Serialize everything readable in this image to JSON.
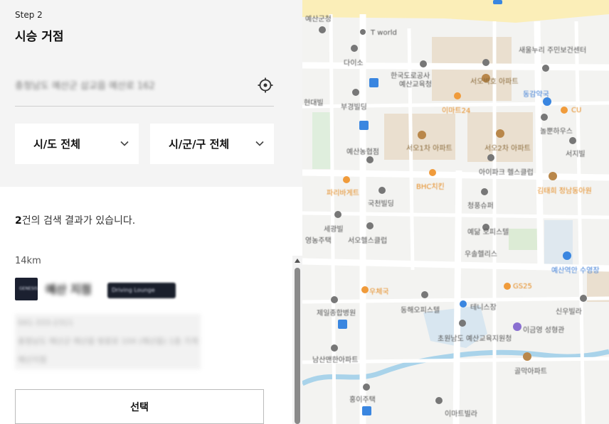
{
  "step": {
    "label": "Step 2",
    "title": "시승 거점"
  },
  "search": {
    "address": "충청남도 예산군 삽교읍 예산로 162",
    "locate_icon": "crosshair-icon"
  },
  "filters": {
    "province": {
      "label": "시/도 전체",
      "icon": "chevron-down-icon"
    },
    "district": {
      "label": "시/군/구 전체",
      "icon": "chevron-down-icon"
    }
  },
  "results": {
    "count": "2",
    "suffix": "건의 검색 결과가 있습니다."
  },
  "store": {
    "distance": "14km",
    "logo_text": "GENESIS",
    "name": "예산 지점",
    "badge": "Driving Lounge",
    "phone": "041-333-2311",
    "address": "충청남도 예산군 예산읍 벚꽃로 104 (예산읍) 1층 가게",
    "branch": "예산지점",
    "select_label": "선택"
  },
  "map": {
    "labels": [
      "예산군청",
      "T world",
      "다이소",
      "한국도로공사",
      "예산교육청",
      "서오벽호 아파트",
      "새울누리 주민보건센터",
      "현대빌",
      "부경빌딩",
      "이마트24",
      "동감약국",
      "CU",
      "놀뿐하우스",
      "서오1차 아파트",
      "서오2차 아파트",
      "예산농협점",
      "아이파크 헬스클럽",
      "서지빌",
      "파리바게트",
      "BHC치킨",
      "청풍슈퍼",
      "김태희 정남동아원",
      "국천빌딩",
      "세광빌",
      "서오헬스클럽",
      "예닮 오피스텔",
      "우솔헬리스",
      "영농주택",
      "우체국",
      "GS25",
      "예산역안 수영장",
      "제일종합병원",
      "동해오피스텔",
      "테니스장",
      "신우빌라",
      "초원남도 예산교육지원청",
      "이금영 성형관",
      "남산맨한아파트",
      "골막아파트",
      "홍이주택",
      "이마트빌라"
    ]
  }
}
